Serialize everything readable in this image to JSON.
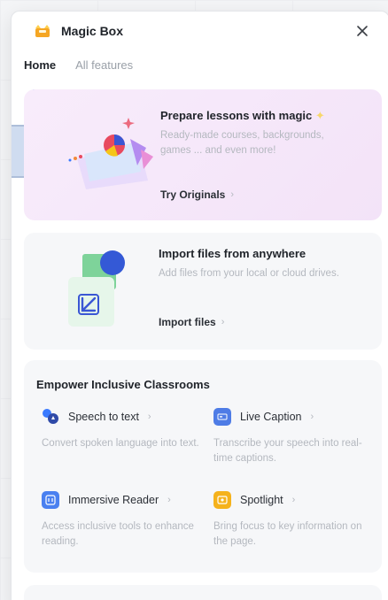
{
  "header": {
    "title": "Magic Box",
    "logo_icon": "magic-box-logo",
    "close_label": "×"
  },
  "tabs": [
    {
      "label": "Home",
      "active": true
    },
    {
      "label": "All features",
      "active": false
    }
  ],
  "cards": {
    "magic": {
      "title": "Prepare lessons with magic",
      "desc": "Ready-made courses, backgrounds, games ... and even more!",
      "link": "Try Originals",
      "chevron": "›"
    },
    "import": {
      "title": "Import files from anywhere",
      "desc": "Add files from your local or cloud drives.",
      "link": "Import files",
      "chevron": "›"
    },
    "inclusive": {
      "title": "Empower Inclusive Classrooms",
      "features": [
        {
          "name": "Speech to text",
          "desc": "Convert spoken language into text.",
          "icon": "speech-icon",
          "color": "#3a7afe"
        },
        {
          "name": "Live Caption",
          "desc": "Transcribe your speech into real-time captions.",
          "icon": "caption-icon",
          "color": "#4e7ce6"
        },
        {
          "name": "Immersive Reader",
          "desc": "Access inclusive tools to enhance reading.",
          "icon": "reader-icon",
          "color": "#4a80f0"
        },
        {
          "name": "Spotlight",
          "desc": "Bring focus to key information on the page.",
          "icon": "spotlight-icon",
          "color": "#f5b21c"
        }
      ],
      "chevron": "›"
    }
  },
  "colors": {
    "accent": "#3a7afe",
    "magic_card_bg": "#f5e6fa",
    "spotlight": "#f5b21c",
    "muted_text": "#b4b8bf"
  }
}
